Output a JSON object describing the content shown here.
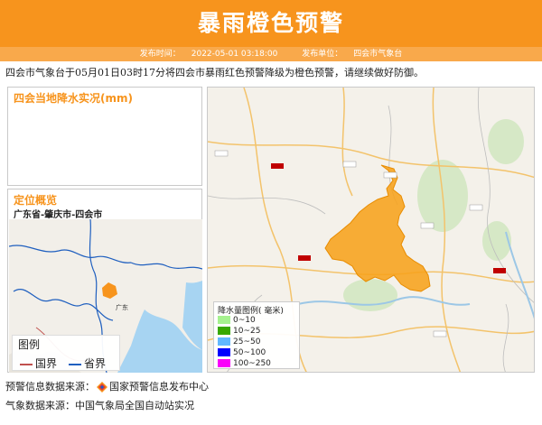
{
  "header": {
    "title": "暴雨橙色预警",
    "publish_time_label": "发布时间：",
    "publish_time": "2022-05-01 03:18:00",
    "publisher_label": "发布单位：",
    "publisher": "四会市气象台"
  },
  "description": "四会市气象台于05月01日03时17分将四会市暴雨红色预警降级为橙色预警，请继续做好防御。",
  "rain_panel": {
    "title": "四会当地降水实况(mm)"
  },
  "location_panel": {
    "title": "定位概览",
    "path": "广东省-肇庆市-四会市",
    "legend": {
      "title": "图例",
      "items": [
        {
          "label": "国界",
          "color": "#c0504d"
        },
        {
          "label": "省界",
          "color": "#1f5fbf"
        }
      ]
    },
    "mini_map_city_label": "广东"
  },
  "rain_legend": {
    "title": "降水量图例( 毫米)",
    "items": [
      {
        "label": "0~10",
        "color": "#a6f28f"
      },
      {
        "label": "10~25",
        "color": "#38a800"
      },
      {
        "label": "25~50",
        "color": "#61b8ff"
      },
      {
        "label": "50~100",
        "color": "#0000fe"
      },
      {
        "label": "100~250",
        "color": "#fa00fa"
      }
    ]
  },
  "footer": {
    "warning_source_label": "预警信息数据来源：",
    "warning_source": "国家预警信息发布中心",
    "weather_source_label": "气象数据来源：",
    "weather_source": "中国气象局全国自动站实况"
  },
  "colors": {
    "accent": "#f7941d",
    "warning_area": "#f7a21b"
  }
}
